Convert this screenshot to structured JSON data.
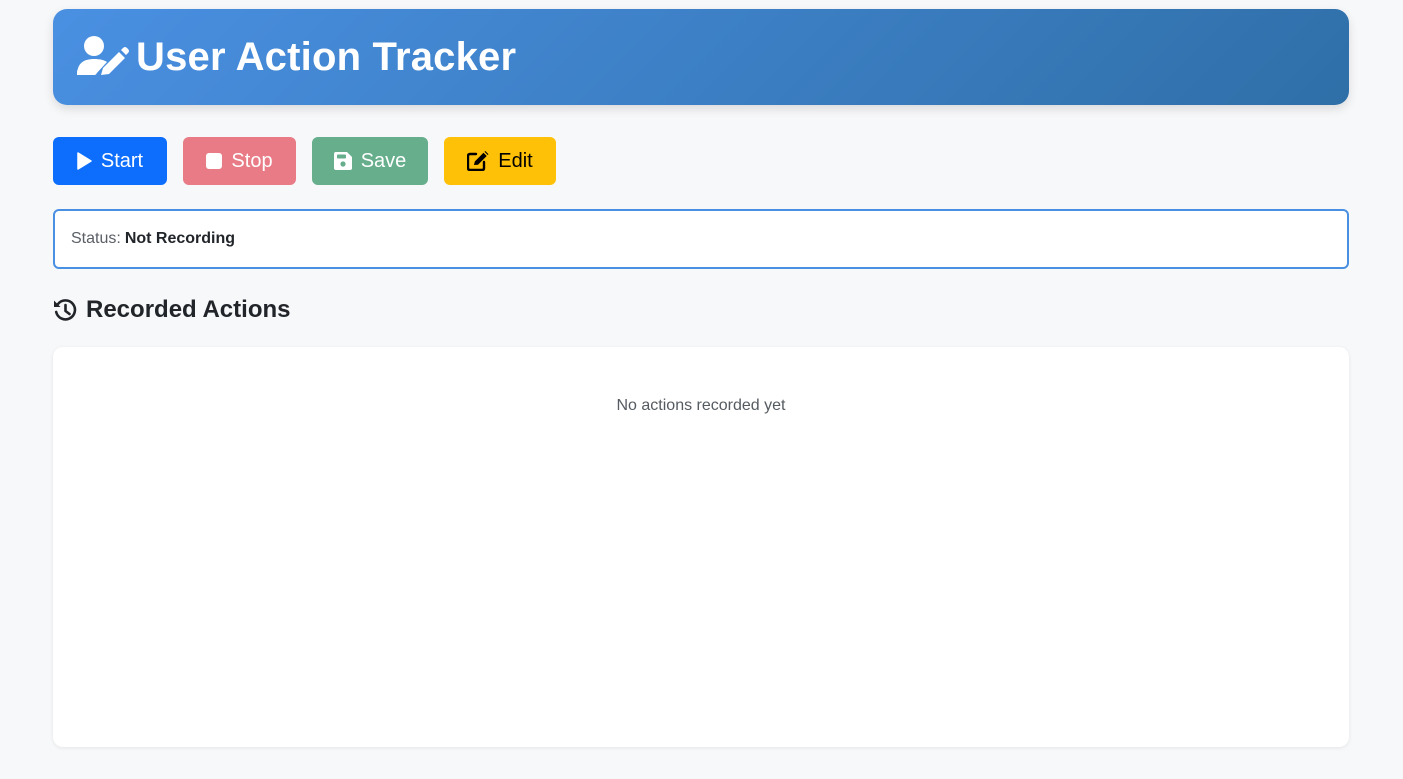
{
  "header": {
    "title": "User Action Tracker",
    "icon": "user-edit-icon"
  },
  "toolbar": {
    "start_label": "Start",
    "stop_label": "Stop",
    "save_label": "Save",
    "edit_label": "Edit",
    "start_icon": "play-icon",
    "stop_icon": "stop-icon",
    "save_icon": "floppy-disk-icon",
    "edit_icon": "edit-icon"
  },
  "status": {
    "label": "Status:",
    "value": "Not Recording"
  },
  "actions": {
    "section_title": "Recorded Actions",
    "section_icon": "history-icon",
    "empty_message": "No actions recorded yet"
  },
  "colors": {
    "header_gradient_start": "#4a90e2",
    "header_gradient_end": "#2f6fa8",
    "start": "#0d6efd",
    "stop": "#e87b85",
    "save": "#67ae8c",
    "edit": "#ffc107",
    "status_border": "#4a90e2"
  }
}
